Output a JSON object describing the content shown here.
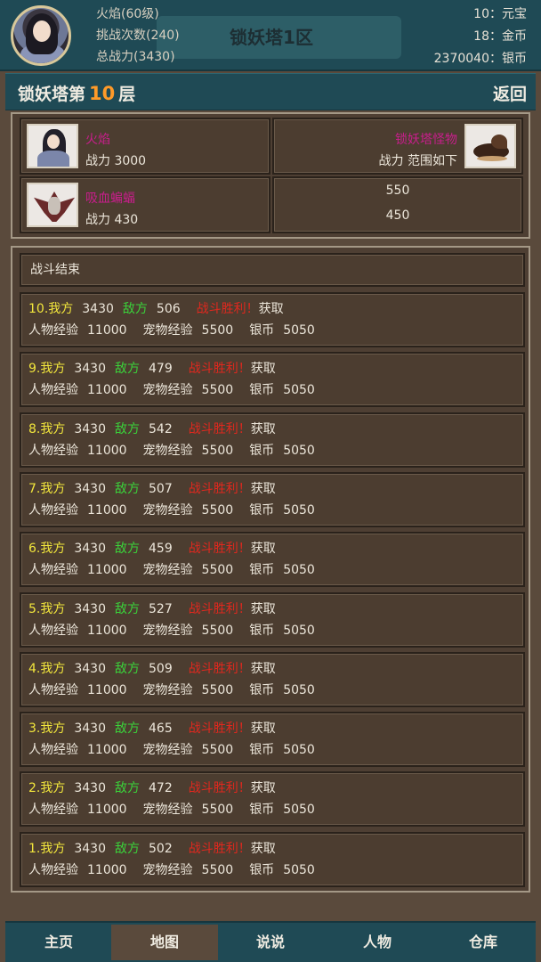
{
  "header": {
    "player_name_level": "火焰(60级)",
    "challenge_count": "挑战次数(240)",
    "total_power": "总战力(3430)",
    "server": "锁妖塔1区",
    "currency": [
      "10：元宝",
      "18：金币",
      "2370040：银币"
    ]
  },
  "title_bar": {
    "prefix": "锁妖塔第",
    "floor": "10",
    "suffix": "层",
    "back_label": "返回"
  },
  "battle_info": {
    "player": {
      "name": "火焰",
      "power": "战力 3000"
    },
    "enemy_group": {
      "name": "锁妖塔怪物",
      "power": "战力 范围如下"
    },
    "monster": {
      "name": "吸血蝙蝠",
      "power": "战力 430"
    },
    "range_max": "550",
    "range_min": "450"
  },
  "log": {
    "status": "战斗结束",
    "rows": [
      {
        "our": "10.我方",
        "our_val": "3430",
        "enemy": "敌方",
        "enemy_val": "506",
        "result": "战斗胜利！",
        "get": "获取",
        "exp_label": "人物经验",
        "exp": "11000",
        "pet_label": "宠物经验",
        "pet": "5500",
        "silver_label": "银币",
        "silver": "5050"
      },
      {
        "our": "9.我方",
        "our_val": "3430",
        "enemy": "敌方",
        "enemy_val": "479",
        "result": "战斗胜利！",
        "get": "获取",
        "exp_label": "人物经验",
        "exp": "11000",
        "pet_label": "宠物经验",
        "pet": "5500",
        "silver_label": "银币",
        "silver": "5050"
      },
      {
        "our": "8.我方",
        "our_val": "3430",
        "enemy": "敌方",
        "enemy_val": "542",
        "result": "战斗胜利！",
        "get": "获取",
        "exp_label": "人物经验",
        "exp": "11000",
        "pet_label": "宠物经验",
        "pet": "5500",
        "silver_label": "银币",
        "silver": "5050"
      },
      {
        "our": "7.我方",
        "our_val": "3430",
        "enemy": "敌方",
        "enemy_val": "507",
        "result": "战斗胜利！",
        "get": "获取",
        "exp_label": "人物经验",
        "exp": "11000",
        "pet_label": "宠物经验",
        "pet": "5500",
        "silver_label": "银币",
        "silver": "5050"
      },
      {
        "our": "6.我方",
        "our_val": "3430",
        "enemy": "敌方",
        "enemy_val": "459",
        "result": "战斗胜利！",
        "get": "获取",
        "exp_label": "人物经验",
        "exp": "11000",
        "pet_label": "宠物经验",
        "pet": "5500",
        "silver_label": "银币",
        "silver": "5050"
      },
      {
        "our": "5.我方",
        "our_val": "3430",
        "enemy": "敌方",
        "enemy_val": "527",
        "result": "战斗胜利！",
        "get": "获取",
        "exp_label": "人物经验",
        "exp": "11000",
        "pet_label": "宠物经验",
        "pet": "5500",
        "silver_label": "银币",
        "silver": "5050"
      },
      {
        "our": "4.我方",
        "our_val": "3430",
        "enemy": "敌方",
        "enemy_val": "509",
        "result": "战斗胜利！",
        "get": "获取",
        "exp_label": "人物经验",
        "exp": "11000",
        "pet_label": "宠物经验",
        "pet": "5500",
        "silver_label": "银币",
        "silver": "5050"
      },
      {
        "our": "3.我方",
        "our_val": "3430",
        "enemy": "敌方",
        "enemy_val": "465",
        "result": "战斗胜利！",
        "get": "获取",
        "exp_label": "人物经验",
        "exp": "11000",
        "pet_label": "宠物经验",
        "pet": "5500",
        "silver_label": "银币",
        "silver": "5050"
      },
      {
        "our": "2.我方",
        "our_val": "3430",
        "enemy": "敌方",
        "enemy_val": "472",
        "result": "战斗胜利！",
        "get": "获取",
        "exp_label": "人物经验",
        "exp": "11000",
        "pet_label": "宠物经验",
        "pet": "5500",
        "silver_label": "银币",
        "silver": "5050"
      },
      {
        "our": "1.我方",
        "our_val": "3430",
        "enemy": "敌方",
        "enemy_val": "502",
        "result": "战斗胜利！",
        "get": "获取",
        "exp_label": "人物经验",
        "exp": "11000",
        "pet_label": "宠物经验",
        "pet": "5500",
        "silver_label": "银币",
        "silver": "5050"
      }
    ]
  },
  "nav": {
    "items": [
      {
        "label": "主页"
      },
      {
        "label": "地图"
      },
      {
        "label": "说说"
      },
      {
        "label": "人物"
      },
      {
        "label": "仓库"
      }
    ],
    "active": "地图"
  },
  "icons": {
    "avatar": "player-portrait",
    "player_thumb": "player-portrait",
    "enemy_thumb": "tower-monster-icon",
    "monster_thumb": "vampire-bat-icon"
  },
  "colors": {
    "header_bg": "#1f4a55",
    "panel_bg": "#4e3f33",
    "page_bg": "#5a4a3c",
    "floor_number": "#ff9a28",
    "our_side": "#f2e63c",
    "enemy_side": "#3ad23a",
    "victory": "#e0281e",
    "unit_name": "#c81e8c"
  }
}
